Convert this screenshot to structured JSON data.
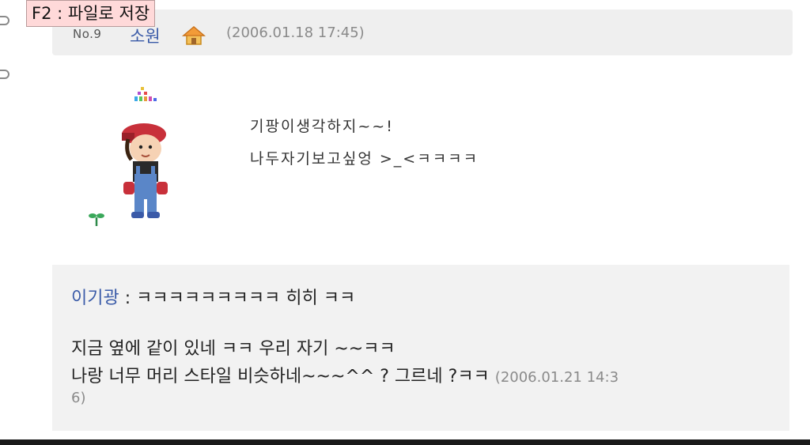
{
  "tooltip": {
    "text": "F2 : 파일로 저장"
  },
  "post": {
    "number": "No.9",
    "author": "소원",
    "date": "(2006.01.18 17:45)",
    "home_icon": "home-icon",
    "avatar_icon": "character-avatar",
    "sprout_icon": "sprout-icon",
    "body_lines": [
      "기팡이생각하지~~!",
      "나두자기보고싶엉 >_<ㅋㅋㅋㅋ"
    ]
  },
  "comment": {
    "author": "이기광",
    "separator": " : ",
    "head_text": "ㅋㅋㅋㅋㅋㅋㅋㅋㅋ 히히 ㅋㅋ",
    "line_1": "지금 옆에 같이 있네 ㅋㅋ 우리 자기 ~~ㅋㅋ",
    "line_2": "나랑 너무 머리 스타일 비슷하네~~~^^ ? 그르네 ?ㅋㅋ ",
    "date_part_1": "(2006.01.21 14:3",
    "date_part_2": "6)"
  },
  "colors": {
    "accent_link": "#3a5ba8",
    "header_bg": "#efefef",
    "comment_bg": "#f2f2f2",
    "tooltip_bg": "#ffd9d9",
    "muted_text": "#8a8a8a"
  }
}
